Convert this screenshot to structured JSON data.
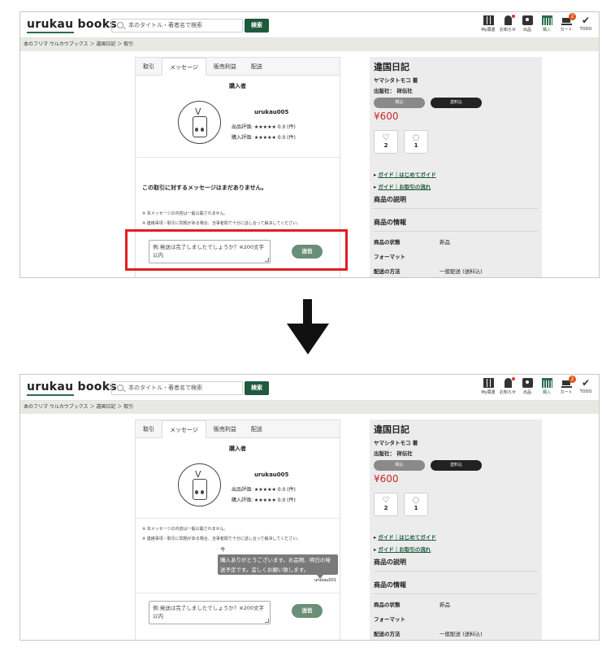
{
  "header": {
    "logo": "urukau books",
    "search_placeholder": "本のタイトル・著者名で検索",
    "search_button": "検索",
    "nav": [
      {
        "label": "My蔵書",
        "icon": "bookshelf-icon"
      },
      {
        "label": "お知らせ",
        "icon": "bell-icon"
      },
      {
        "label": "出品",
        "icon": "camera-icon"
      },
      {
        "label": "購入",
        "icon": "basket-icon"
      },
      {
        "label": "カート",
        "icon": "cart-icon",
        "badge": "2"
      },
      {
        "label": "TODO",
        "icon": "check-icon"
      }
    ]
  },
  "breadcrumb": "本のフリマ ウルカウブックス ＞ 違国日記 ＞ 取引",
  "tabs": [
    "取引",
    "メッセージ",
    "販売利益",
    "配送"
  ],
  "selected_tab": "メッセージ",
  "buyer": {
    "heading": "購入者",
    "username": "urukau005",
    "sell_rating": "出品評価: ★★★★★ 0.0 (件)",
    "buy_rating": "購入評価: ★★★★★ 0.0 (件)"
  },
  "messages": {
    "empty_text": "この取引に対するメッセージはまだありません。",
    "note1": "※ 本メッセージの内容は一般公開されません。",
    "note2": "※ 連絡事項・取引に問題がある場合、当事者間で十分に話し合って解決してください。",
    "input_placeholder": "例:発送は完了しましたでしょうか？※200文字以内",
    "send_button": "送信",
    "sent": {
      "time": "今",
      "text": "購入ありがとうございます。お品物、明日の発送予定です。宜しくお願い致します。",
      "user": "urukau001"
    }
  },
  "book": {
    "title": "違国日記",
    "author": "ヤマシタトモコ 著",
    "publisher": "出版社： 祥伝社",
    "tax_pill": "税込",
    "ship_pill": "送料込",
    "price": "¥600",
    "likes": "2",
    "comments": "1",
    "guide1": "ガイド｜はじめてガイド",
    "guide2": "ガイド｜お取引の流れ",
    "desc_heading": "商品の説明",
    "info_heading": "商品の情報",
    "info": [
      {
        "key": "商品の状態",
        "value": "新品"
      },
      {
        "key": "フォーマット",
        "value": ""
      },
      {
        "key": "配送の方法",
        "value": "一般配送 (送料込)"
      }
    ]
  },
  "colors": {
    "brand_green": "#1f5a3d",
    "send_green": "#6a8e78",
    "price_red": "#c8282b",
    "highlight_red": "#e21c24"
  }
}
